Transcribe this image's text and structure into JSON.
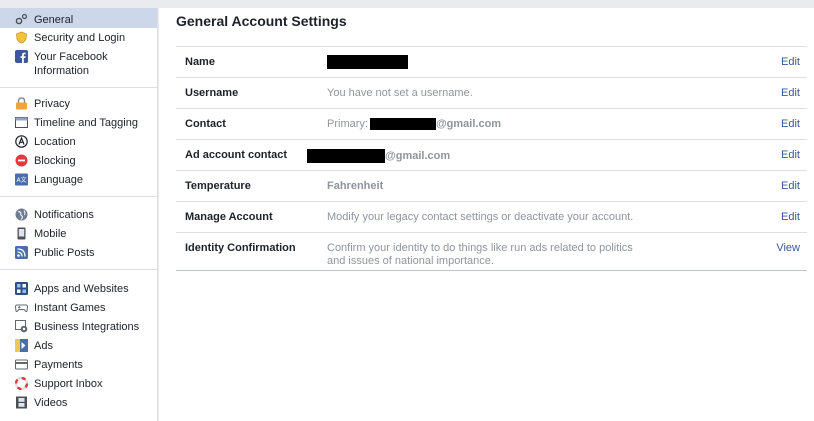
{
  "sidebar": {
    "groups": [
      [
        {
          "label": "General",
          "icon": "gear-icon",
          "active": true
        },
        {
          "label": "Security and Login",
          "icon": "shield-icon"
        },
        {
          "label": "Your Facebook Information",
          "icon": "facebook-icon"
        }
      ],
      [
        {
          "label": "Privacy",
          "icon": "lock-icon"
        },
        {
          "label": "Timeline and Tagging",
          "icon": "timeline-icon"
        },
        {
          "label": "Location",
          "icon": "location-icon"
        },
        {
          "label": "Blocking",
          "icon": "blocking-icon"
        },
        {
          "label": "Language",
          "icon": "language-icon"
        }
      ],
      [
        {
          "label": "Notifications",
          "icon": "globe-icon"
        },
        {
          "label": "Mobile",
          "icon": "mobile-icon"
        },
        {
          "label": "Public Posts",
          "icon": "rss-icon"
        }
      ],
      [
        {
          "label": "Apps and Websites",
          "icon": "apps-icon"
        },
        {
          "label": "Instant Games",
          "icon": "gamepad-icon"
        },
        {
          "label": "Business Integrations",
          "icon": "business-icon"
        },
        {
          "label": "Ads",
          "icon": "ads-icon"
        },
        {
          "label": "Payments",
          "icon": "credit-card-icon"
        },
        {
          "label": "Support Inbox",
          "icon": "lifebuoy-icon"
        },
        {
          "label": "Videos",
          "icon": "film-icon"
        }
      ]
    ]
  },
  "main": {
    "title": "General Account Settings",
    "rows": [
      {
        "key": "Name",
        "value": "",
        "action": "Edit"
      },
      {
        "key": "Username",
        "value": "You have not set a username.",
        "action": "Edit"
      },
      {
        "key": "Contact",
        "value_prefix": "Primary:",
        "value_suffix": "@gmail.com",
        "action": "Edit"
      },
      {
        "key": "Ad account contact",
        "value_suffix": "@gmail.com",
        "action": "Edit"
      },
      {
        "key": "Temperature",
        "value": "Fahrenheit",
        "action": "Edit"
      },
      {
        "key": "Manage Account",
        "value": "Modify your legacy contact settings or deactivate your account.",
        "action": "Edit"
      },
      {
        "key": "Identity Confirmation",
        "value": "Confirm your identity to do things like run ads related to politics and issues of national importance.",
        "action": "View"
      }
    ]
  },
  "colors": {
    "active_bg": "#ccd7ea",
    "link": "#365899",
    "muted": "#90949c"
  }
}
